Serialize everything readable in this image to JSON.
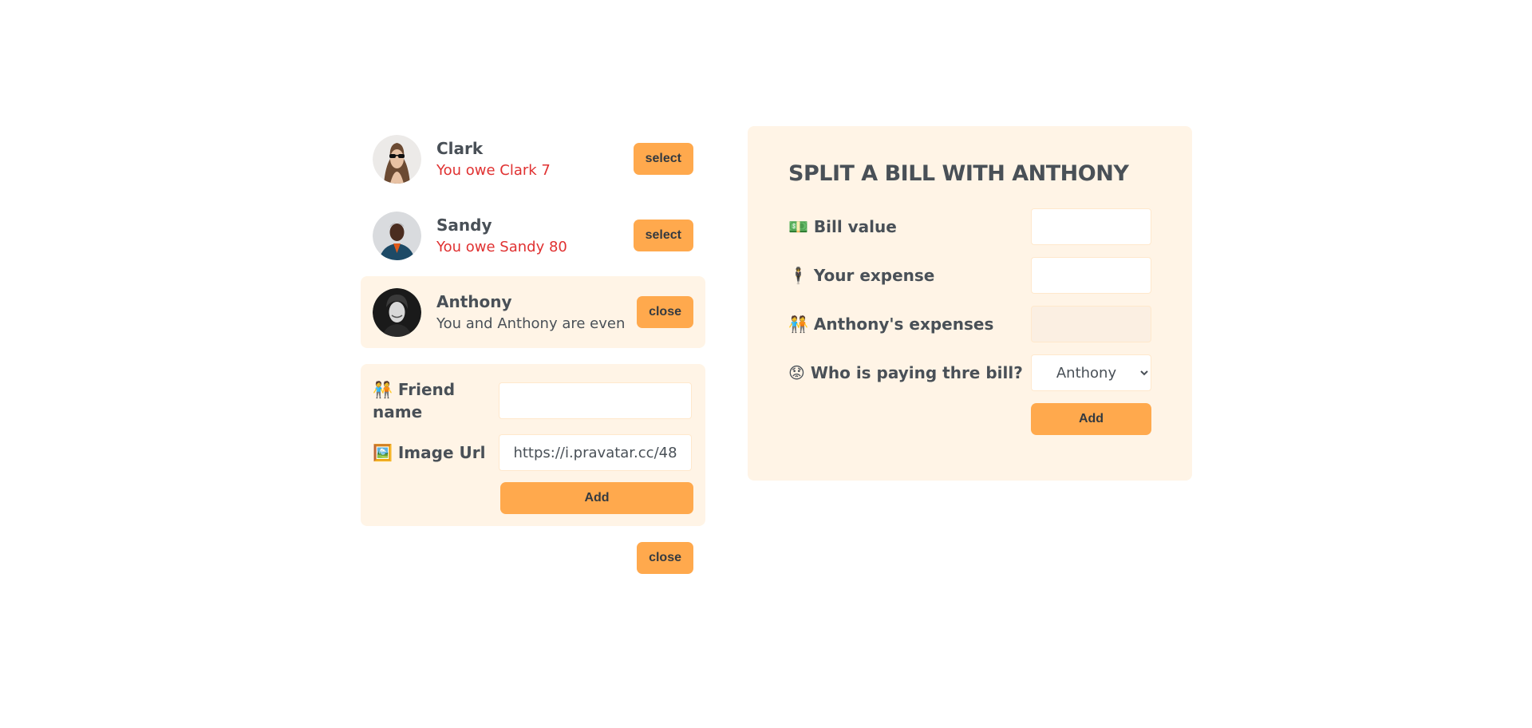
{
  "friends": [
    {
      "name": "Clark",
      "status": "You owe Clark 7",
      "button": "select"
    },
    {
      "name": "Sandy",
      "status": "You owe Sandy 80",
      "button": "select"
    },
    {
      "name": "Anthony",
      "status": "You and Anthony are even",
      "button": "close"
    }
  ],
  "add_friend_form": {
    "name_label": "🧑‍🤝‍🧑 Friend name",
    "name_value": "",
    "image_label": "🖼️ Image Url",
    "image_value": "https://i.pravatar.cc/48",
    "add_label": "Add"
  },
  "close_form_button": "close",
  "split_form": {
    "title": "SPLIT A BILL WITH ANTHONY",
    "bill_label": "💵 Bill value",
    "bill_value": "",
    "your_expense_label": "🕴️ Your expense",
    "your_expense_value": "",
    "friend_expense_label": "🧑‍🤝‍🧑 Anthony's expenses",
    "friend_expense_value": "",
    "payer_label": "😟 Who is paying thre bill?",
    "payer_value": "Anthony",
    "add_label": "Add"
  }
}
